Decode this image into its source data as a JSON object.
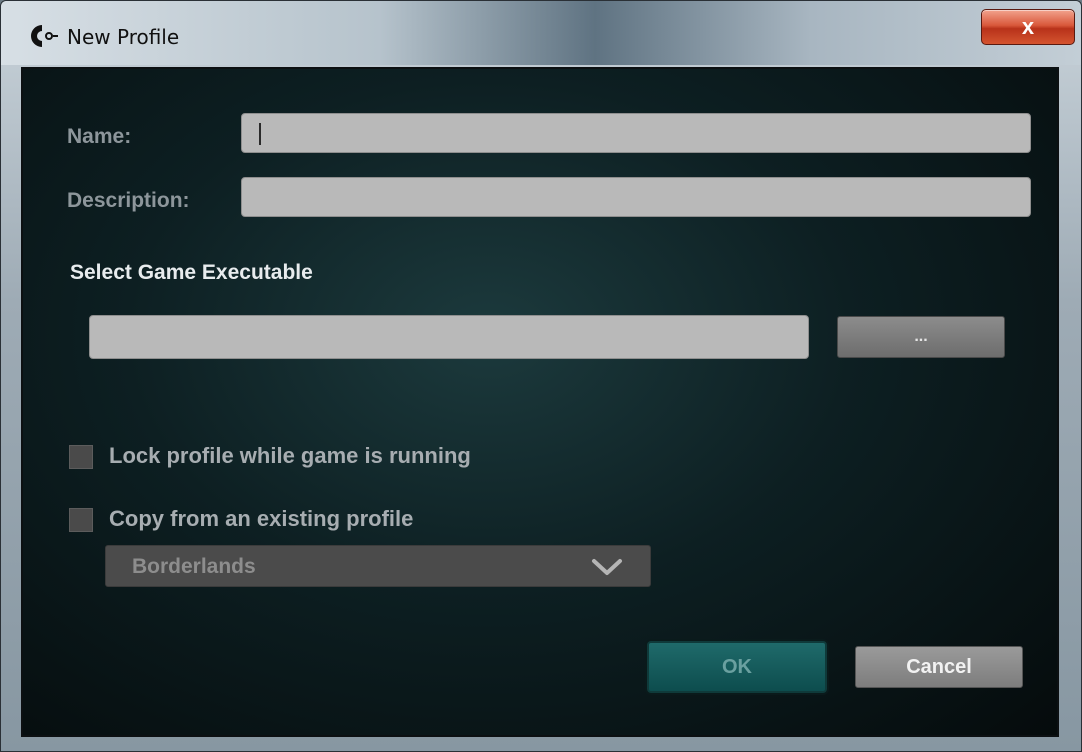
{
  "window": {
    "title": "New Profile",
    "close_glyph": "x",
    "logo_icon": "logitech-g-logo-icon"
  },
  "form": {
    "name_label": "Name:",
    "name_value": "",
    "description_label": "Description:",
    "description_value": "",
    "executable_section_title": "Select Game Executable",
    "executable_value": "",
    "browse_label": "...",
    "lock_label": "Lock profile while game is running",
    "lock_checked": false,
    "copy_label": "Copy from an existing profile",
    "copy_checked": false,
    "copy_profile_selected": "Borderlands"
  },
  "buttons": {
    "ok": "OK",
    "cancel": "Cancel"
  },
  "colors": {
    "accent_ok": "#0d4d4e",
    "background": "#050b0c",
    "close": "#d9583b"
  }
}
